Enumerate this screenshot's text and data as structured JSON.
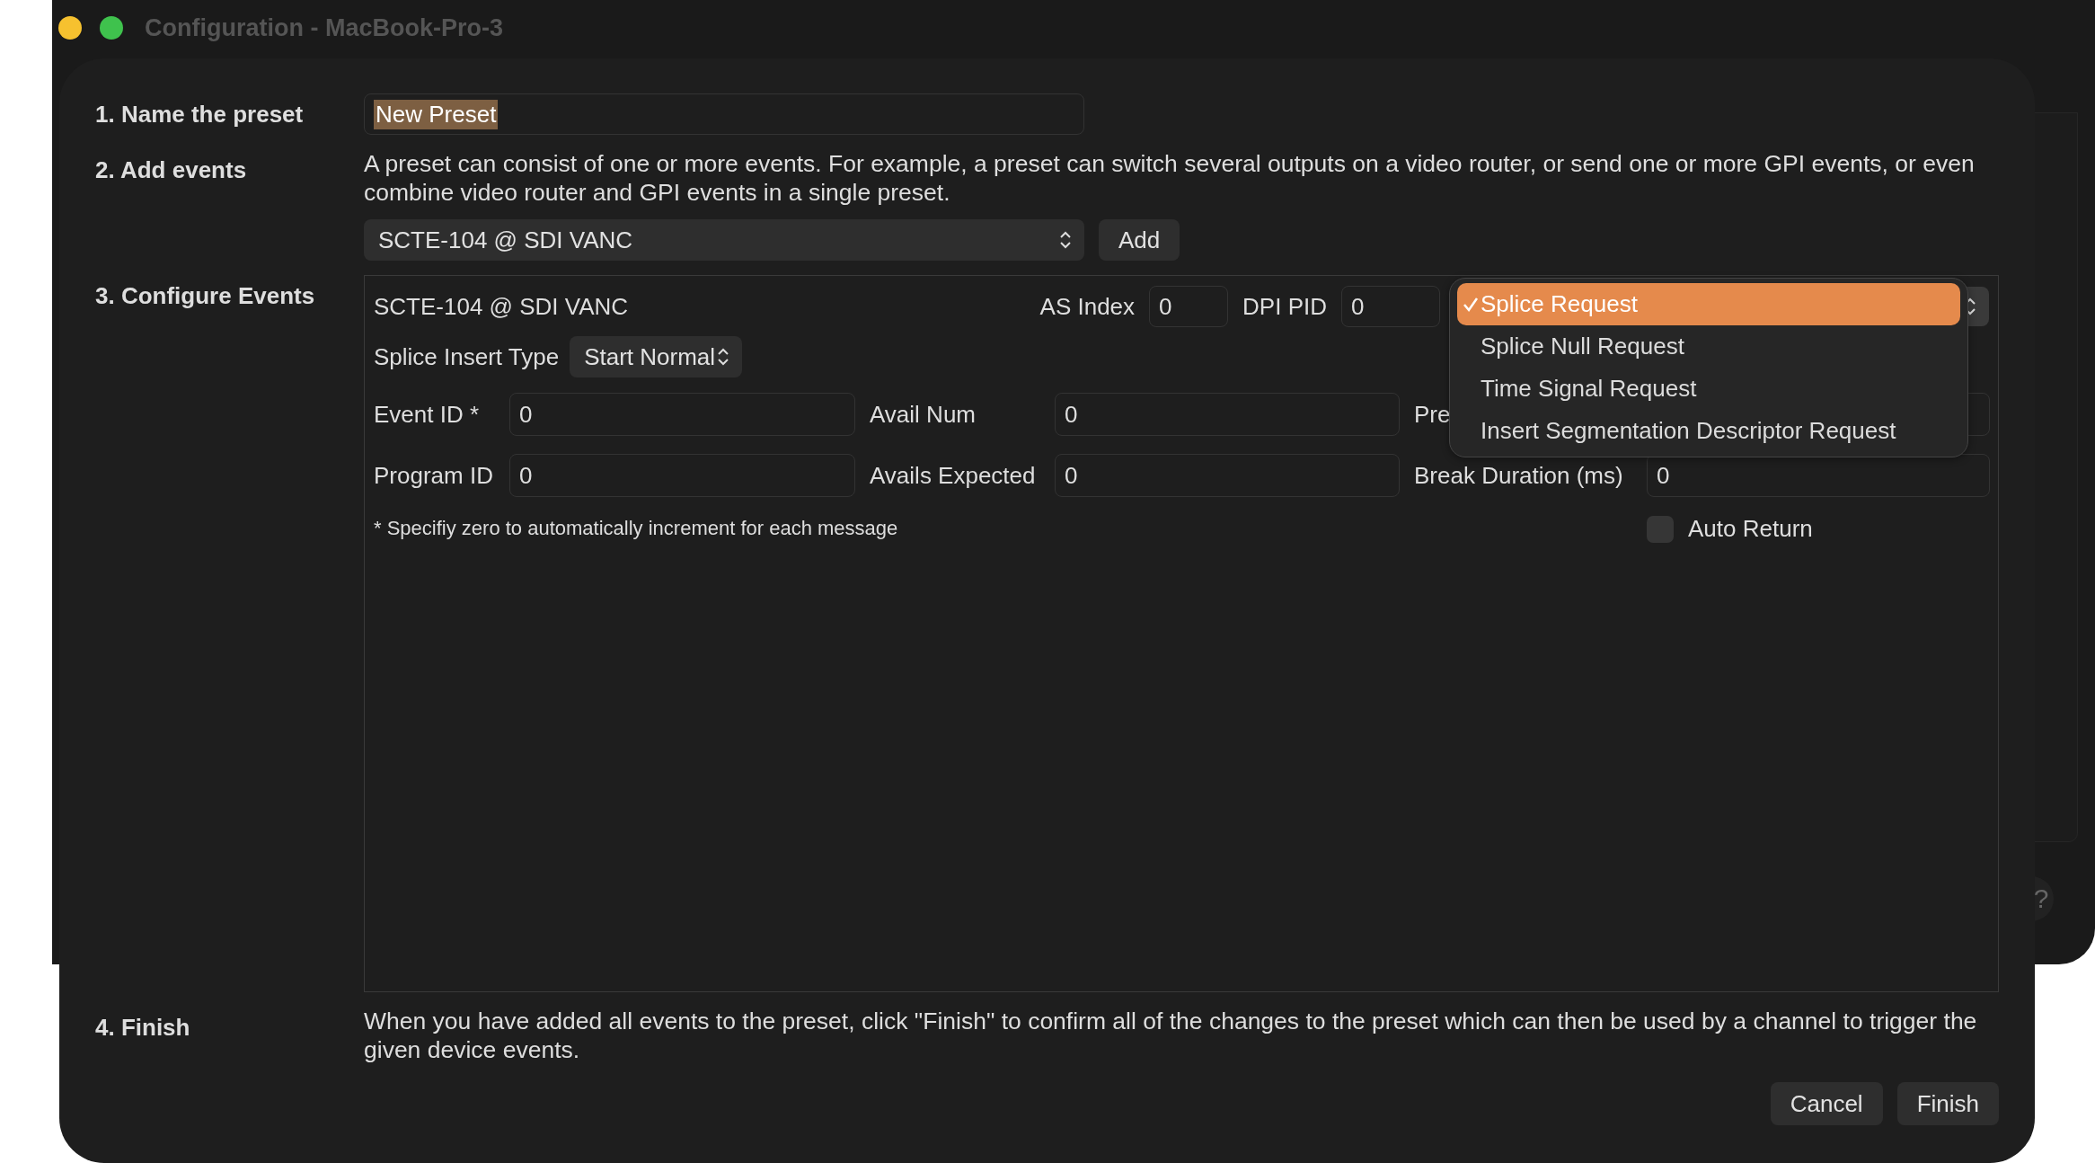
{
  "window": {
    "title": "Configuration - MacBook-Pro-3",
    "help_button": "?"
  },
  "name_step": {
    "label": "1. Name the preset",
    "value": "New Preset",
    "text_selected": true
  },
  "events_step": {
    "label": "2. Add events",
    "description": "A preset can consist of one or more events. For example, a preset can switch several outputs on a video router, or send one or more GPI events, or even combine video router and GPI events in a single preset.",
    "event_type": "SCTE-104 @ SDI VANC",
    "add_button": "Add"
  },
  "configure_step": {
    "label": "3. Configure Events",
    "title": "SCTE-104 @ SDI VANC",
    "header_fields": [
      {
        "label": "AS Index",
        "value": "0"
      },
      {
        "label": "DPI PID",
        "value": "0"
      }
    ],
    "splice_insert_type": {
      "label": "Splice Insert Type",
      "value": "Start Normal"
    },
    "fields": [
      {
        "label": "Event ID *",
        "value": "0"
      },
      {
        "label": "Avail Num",
        "value": "0"
      },
      {
        "label": "Pre"
      },
      {
        "label": "Program ID",
        "value": "0"
      },
      {
        "label": "Avails Expected",
        "value": "0"
      },
      {
        "label": "Break Duration (ms)",
        "value": "0"
      }
    ],
    "note": "* Specifiy zero to automatically increment for each message",
    "auto_return": {
      "label": "Auto Return",
      "checked": false
    },
    "request_menu": [
      {
        "label": "Splice Request",
        "selected": true
      },
      {
        "label": "Splice Null Request",
        "selected": false
      },
      {
        "label": "Time Signal Request",
        "selected": false
      },
      {
        "label": "Insert Segmentation Descriptor Request",
        "selected": false
      }
    ]
  },
  "finish_step": {
    "label": "4. Finish",
    "description": "When you have added all events to the preset, click \"Finish\" to confirm all of the changes to the preset which can then be used by a channel to trigger the given device events.",
    "buttons": [
      "Cancel",
      "Finish"
    ]
  }
}
